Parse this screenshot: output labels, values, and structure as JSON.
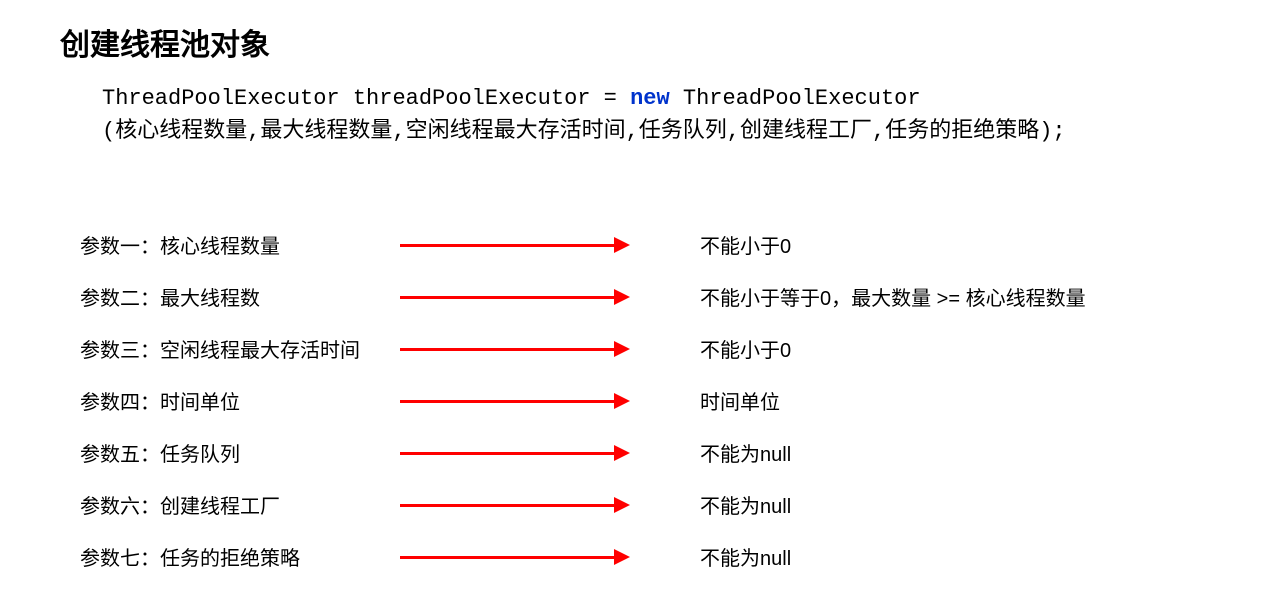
{
  "title": "创建线程池对象",
  "code": {
    "line1_before": "ThreadPoolExecutor threadPoolExecutor = ",
    "line1_kw": "new",
    "line1_after": " ThreadPoolExecutor",
    "line2": "(核心线程数量,最大线程数量,空闲线程最大存活时间,任务队列,创建线程工厂,任务的拒绝策略);"
  },
  "params": [
    {
      "left": "参数一：核心线程数量",
      "right": "不能小于0"
    },
    {
      "left": "参数二：最大线程数",
      "right": "不能小于等于0，最大数量 >= 核心线程数量"
    },
    {
      "left": "参数三：空闲线程最大存活时间",
      "right": "不能小于0"
    },
    {
      "left": "参数四：时间单位",
      "right": "时间单位"
    },
    {
      "left": "参数五：任务队列",
      "right": "不能为null"
    },
    {
      "left": "参数六：创建线程工厂",
      "right": "不能为null"
    },
    {
      "left": "参数七：任务的拒绝策略",
      "right": "不能为null"
    }
  ]
}
